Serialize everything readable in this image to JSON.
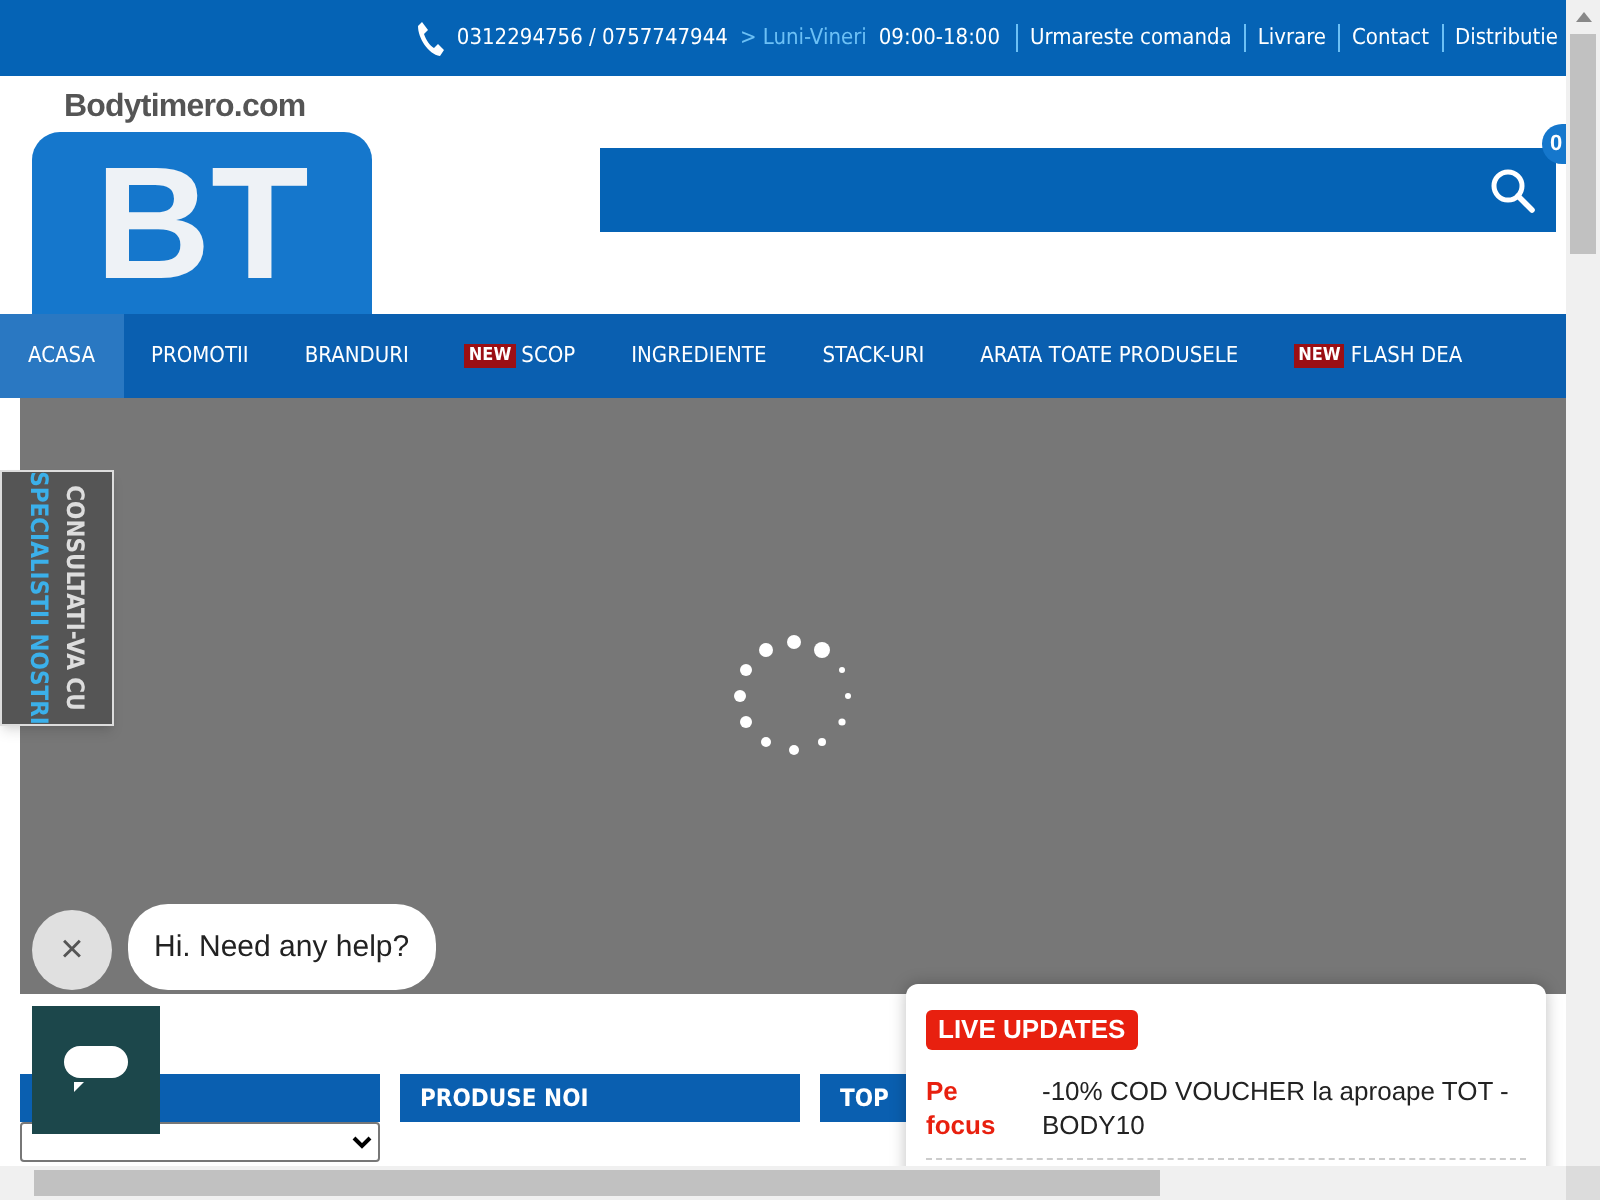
{
  "topbar": {
    "phone": "0312294756 / 0757747944",
    "days": "> Luni-Vineri",
    "hours": "09:00-18:00",
    "links": [
      "Urmareste comanda",
      "Livrare",
      "Contact",
      "Distributie"
    ]
  },
  "header": {
    "wordmark": "Bodytimero.com",
    "monogram": "BT",
    "cart_count": "0"
  },
  "nav": [
    {
      "label": "ACASA",
      "selected": true
    },
    {
      "label": "PROMOTII",
      "selected": false
    },
    {
      "label": "BRANDURI",
      "selected": false
    },
    {
      "label": "SCOP",
      "selected": false,
      "badge": "NEW"
    },
    {
      "label": "INGREDIENTE",
      "selected": false
    },
    {
      "label": "STACK-URI",
      "selected": false
    },
    {
      "label": "ARATA TOATE PRODUSELE",
      "selected": false
    },
    {
      "label": "FLASH DEA",
      "selected": false,
      "badge": "NEW"
    }
  ],
  "side_tab": {
    "line_1": "CONSULTATI-VA CU",
    "line_2": "SPECIALISTII NOSTRI"
  },
  "chat": {
    "close": "×",
    "greeting": "Hi. Need any help?"
  },
  "columns": [
    {},
    {
      "title": "PRODUSE NOI"
    },
    {
      "title": "TOP"
    }
  ],
  "live_updates": {
    "badge": "LIVE UPDATES",
    "label": "Pe focus",
    "text": "-10% COD VOUCHER la aproape TOT - BODY10"
  }
}
